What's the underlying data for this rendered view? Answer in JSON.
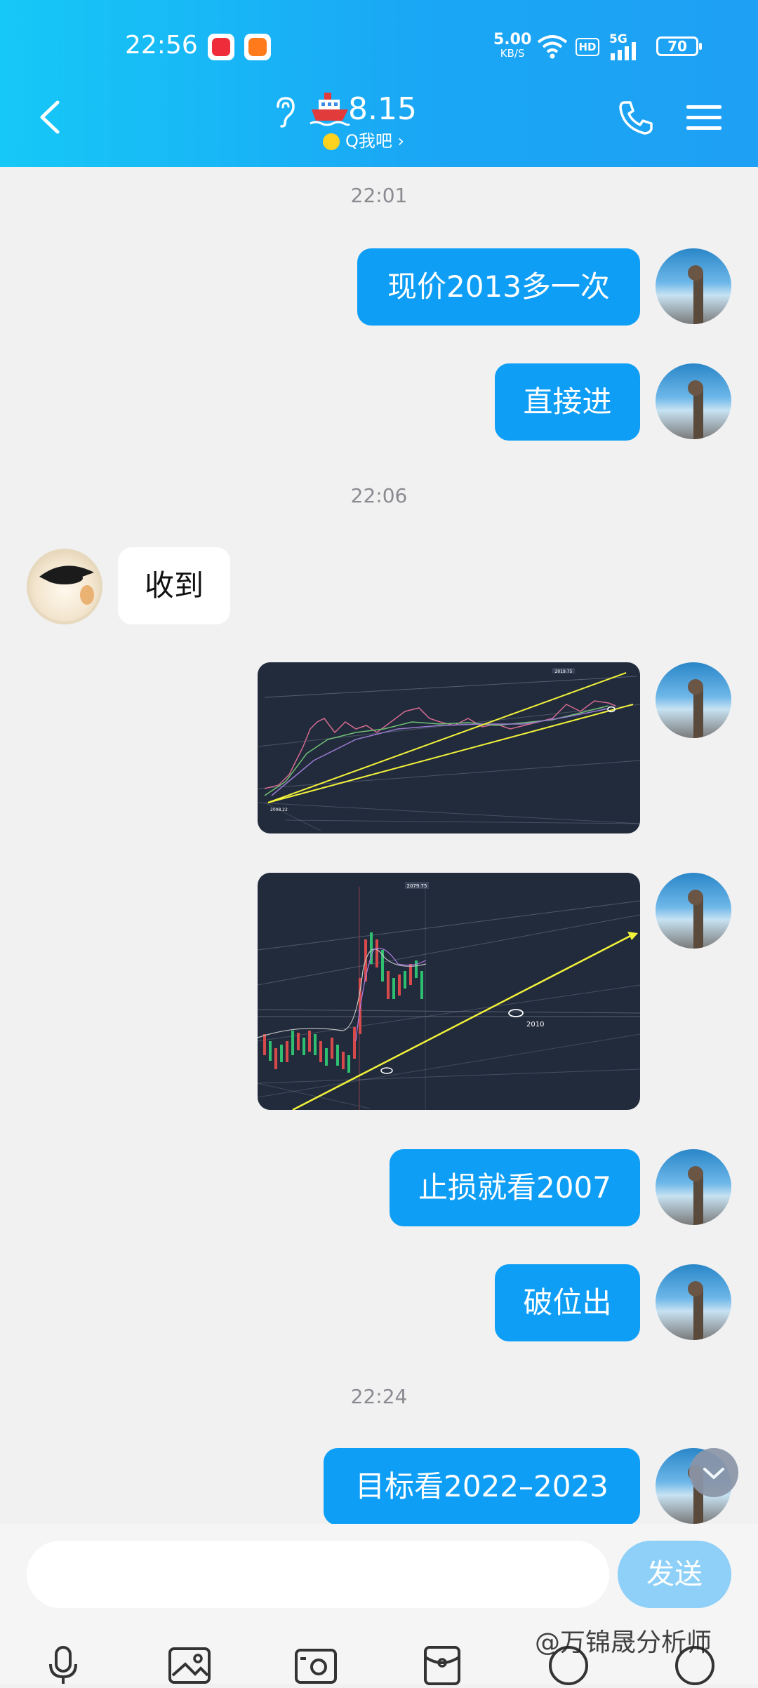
{
  "status_bar": {
    "time": "22:56",
    "net_speed": "5.00",
    "net_unit": "KB/S",
    "hd": "HD",
    "network": "5G",
    "battery": "70"
  },
  "header": {
    "title": "8.15",
    "subtitle": "Q我吧 ›",
    "accent": "#1aa7f5"
  },
  "messages": {
    "t1": "22:01",
    "m1": "现价2013多一次",
    "m2": "直接进",
    "t2": "22:06",
    "m3": "收到",
    "chart1": {
      "price_label": "2019.75",
      "low_label": "2008.22"
    },
    "chart2": {
      "top_label": "2079.75",
      "support_label": "2010"
    },
    "m4": "止损就看2007",
    "m5": "破位出",
    "t3": "22:24",
    "m6": "目标看2022–2023"
  },
  "input": {
    "placeholder": "",
    "send_label": "发送"
  },
  "watermark": "万锦晟分析师"
}
